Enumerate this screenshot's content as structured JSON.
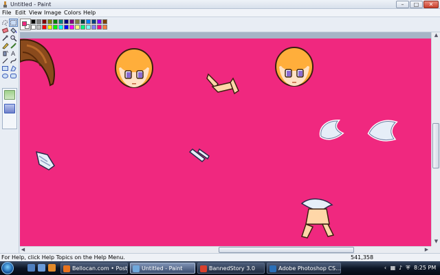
{
  "window": {
    "title": "Untitled - Paint",
    "icon": "paint-app-icon",
    "controls": {
      "minimize": "–",
      "maximize": "□",
      "close": "✕"
    }
  },
  "menu": {
    "file": "File",
    "edit": "Edit",
    "view": "View",
    "image": "Image",
    "colors": "Colors",
    "help": "Help"
  },
  "palette": {
    "foreground": "#f0287f",
    "background": "#ffffff",
    "colors": [
      "#000000",
      "#808080",
      "#800000",
      "#808000",
      "#008000",
      "#008080",
      "#000080",
      "#800080",
      "#808040",
      "#004040",
      "#0080ff",
      "#004080",
      "#8000ff",
      "#804000",
      "#ffffff",
      "#c0c0c0",
      "#ff0000",
      "#ffff00",
      "#00ff00",
      "#00ffff",
      "#0000ff",
      "#ff00ff",
      "#ffff80",
      "#00ff80",
      "#80ffff",
      "#8080ff",
      "#ff0080",
      "#ff8040"
    ]
  },
  "tools": [
    {
      "icon": "free-form-select-icon"
    },
    {
      "icon": "select-icon",
      "active": true
    },
    {
      "icon": "eraser-icon"
    },
    {
      "icon": "fill-bucket-icon"
    },
    {
      "icon": "color-picker-icon"
    },
    {
      "icon": "magnifier-icon"
    },
    {
      "icon": "pencil-icon"
    },
    {
      "icon": "brush-icon"
    },
    {
      "icon": "airbrush-icon"
    },
    {
      "icon": "text-icon"
    },
    {
      "icon": "line-icon"
    },
    {
      "icon": "curve-icon"
    },
    {
      "icon": "rectangle-icon"
    },
    {
      "icon": "polygon-icon"
    },
    {
      "icon": "ellipse-icon"
    },
    {
      "icon": "rounded-rectangle-icon"
    }
  ],
  "canvas": {
    "background_color": "#f0287f"
  },
  "statusbar": {
    "help_text": "For Help, click Help Topics on the Help Menu.",
    "coords": "541,358"
  },
  "taskbar": {
    "buttons": [
      {
        "label": "Bellocan.com • Post ...",
        "icon_color": "#e8731e"
      },
      {
        "label": "Untitled - Paint",
        "icon_color": "#6fa8dc",
        "active": true
      },
      {
        "label": "BannedStory 3.0",
        "icon_color": "#d9402c"
      },
      {
        "label": "Adobe Photoshop CS...",
        "icon_color": "#2a6fb8"
      }
    ],
    "tray_icons": [
      "chevron-up-icon",
      "network-icon",
      "volume-icon",
      "security-icon"
    ],
    "clock": "8:25 PM"
  }
}
